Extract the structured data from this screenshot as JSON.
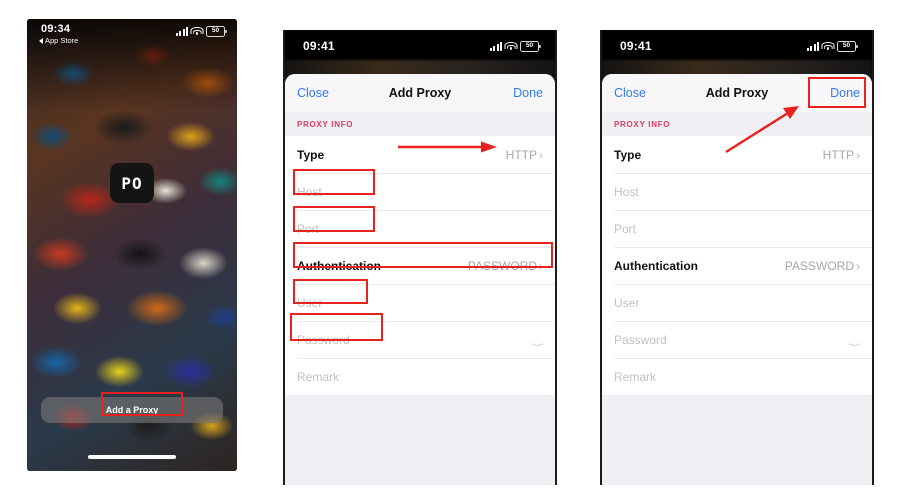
{
  "panels": [
    {
      "id": "home-screen",
      "status": {
        "time": "09:34",
        "back_label": "App Store",
        "battery": "50"
      },
      "app_badge": "PO",
      "add_button": "Add a Proxy"
    },
    {
      "id": "add-proxy-annotated",
      "status": {
        "time": "09:41",
        "battery": "50"
      },
      "nav": {
        "close": "Close",
        "title": "Add Proxy",
        "done": "Done"
      },
      "section_header": "PROXY INFO",
      "rows": [
        {
          "label": "Type",
          "value": "HTTP",
          "chevron": "›",
          "placeholder": false
        },
        {
          "label": "Host",
          "value": "",
          "chevron": "",
          "placeholder": true
        },
        {
          "label": "Port",
          "value": "",
          "chevron": "",
          "placeholder": true
        },
        {
          "label": "Authentication",
          "value": "PASSWORD",
          "chevron": "›",
          "placeholder": false
        },
        {
          "label": "User",
          "value": "",
          "chevron": "",
          "placeholder": true
        },
        {
          "label": "Password",
          "value": "",
          "chevron": "",
          "placeholder": true,
          "eye": true
        },
        {
          "label": "Remark",
          "value": "",
          "chevron": "",
          "placeholder": true
        }
      ]
    },
    {
      "id": "add-proxy-done",
      "status": {
        "time": "09:41",
        "battery": "50"
      },
      "nav": {
        "close": "Close",
        "title": "Add Proxy",
        "done": "Done"
      },
      "section_header": "PROXY INFO",
      "rows": [
        {
          "label": "Type",
          "value": "HTTP",
          "chevron": "›",
          "placeholder": false
        },
        {
          "label": "Host",
          "value": "",
          "chevron": "",
          "placeholder": true
        },
        {
          "label": "Port",
          "value": "",
          "chevron": "",
          "placeholder": true
        },
        {
          "label": "Authentication",
          "value": "PASSWORD",
          "chevron": "›",
          "placeholder": false
        },
        {
          "label": "User",
          "value": "",
          "chevron": "",
          "placeholder": true
        },
        {
          "label": "Password",
          "value": "",
          "chevron": "",
          "placeholder": true,
          "eye": true
        },
        {
          "label": "Remark",
          "value": "",
          "chevron": "",
          "placeholder": true
        }
      ]
    }
  ],
  "annotation_color": "#e8221c"
}
